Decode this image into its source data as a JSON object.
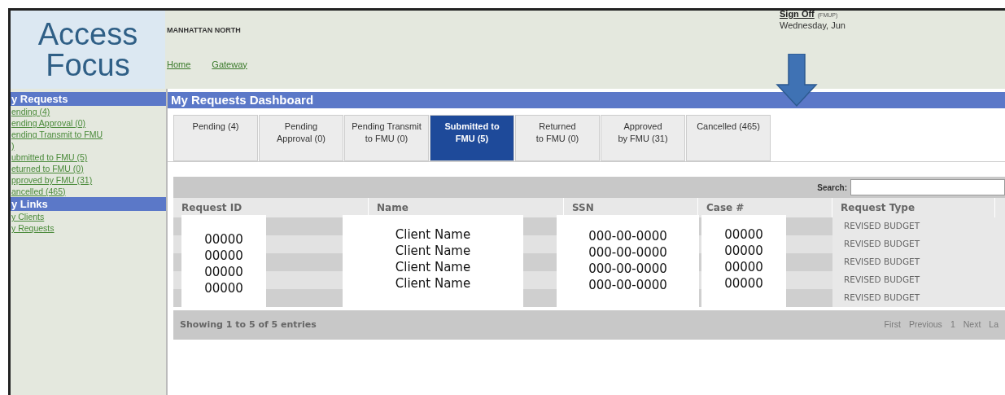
{
  "header": {
    "logo_lines": [
      "Access",
      "Focus"
    ],
    "office": "MANHATTAN NORTH",
    "nav_links": [
      "Home",
      "Gateway"
    ],
    "sign_off": "Sign Off",
    "user": "(FMUP)",
    "date": "Wednesday, Jun"
  },
  "sidebar": {
    "sections": [
      {
        "title": "y Requests",
        "items": [
          {
            "lines": [
              "ending (4)"
            ]
          },
          {
            "lines": [
              "ending Approval (0)"
            ]
          },
          {
            "lines": [
              "ending Transmit to FMU",
              ")"
            ]
          },
          {
            "lines": [
              "ubmitted to FMU (5)"
            ]
          },
          {
            "lines": [
              "eturned to FMU (0)"
            ]
          },
          {
            "lines": [
              "pproved by FMU (31)"
            ]
          },
          {
            "lines": [
              "ancelled (465)"
            ]
          }
        ]
      },
      {
        "title": "y Links",
        "items": [
          {
            "lines": [
              "y Clients"
            ]
          },
          {
            "lines": [
              "y Requests"
            ]
          }
        ]
      }
    ]
  },
  "dashboard": {
    "title": "My Requests Dashboard",
    "tabs": [
      {
        "lines": [
          "Pending (4)"
        ],
        "selected": false
      },
      {
        "lines": [
          "Pending",
          "Approval (0)"
        ],
        "selected": false
      },
      {
        "lines": [
          "Pending Transmit",
          "to FMU (0)"
        ],
        "selected": false
      },
      {
        "lines": [
          "Submitted to",
          "FMU (5)"
        ],
        "selected": true
      },
      {
        "lines": [
          "Returned",
          "to FMU (0)"
        ],
        "selected": false
      },
      {
        "lines": [
          "Approved",
          "by FMU (31)"
        ],
        "selected": false
      },
      {
        "lines": [
          "Cancelled (465)"
        ],
        "selected": false
      }
    ],
    "search_label": "Search:",
    "table": {
      "columns": [
        "Request ID",
        "Name",
        "SSN",
        "Case #",
        "Request Type"
      ],
      "redacted_columns": [
        [
          "00000",
          "00000",
          "00000",
          "00000"
        ],
        [
          "Client Name",
          "Client Name",
          "Client Name",
          "Client Name"
        ],
        [
          "000-00-0000",
          "000-00-0000",
          "000-00-0000",
          "000-00-0000"
        ],
        [
          "00000",
          "00000",
          "00000",
          "00000"
        ]
      ],
      "request_types": [
        "REVISED BUDGET",
        "REVISED BUDGET",
        "REVISED BUDGET",
        "REVISED BUDGET",
        "REVISED BUDGET"
      ]
    },
    "info": "Showing 1 to 5 of 5 entries",
    "pagination": [
      {
        "label": "First",
        "disabled": true
      },
      {
        "label": "Previous",
        "disabled": true
      },
      {
        "label": "1",
        "disabled": true
      },
      {
        "label": "Next",
        "disabled": true
      },
      {
        "label": "La",
        "disabled": true
      }
    ]
  }
}
